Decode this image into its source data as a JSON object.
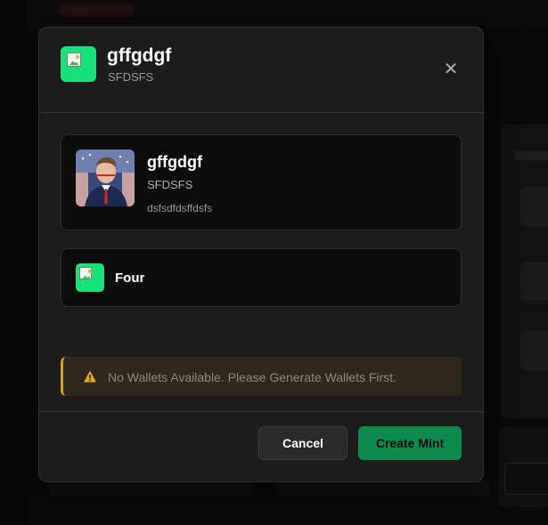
{
  "modal": {
    "title": "gffgdgf",
    "subtitle": "SFDSFS",
    "close_label": "✕"
  },
  "token": {
    "name": "gffgdgf",
    "symbol": "SFDSFS",
    "description": "dsfsdfdsffdsfs"
  },
  "platform": {
    "name": "Four"
  },
  "warning": {
    "message": "No Wallets Available. Please Generate Wallets First."
  },
  "actions": {
    "cancel_label": "Cancel",
    "create_label": "Create Mint"
  },
  "colors": {
    "accent_green": "#18e07a",
    "primary_button": "#0f8a4e",
    "warning_border": "#d6a425"
  },
  "icons": {
    "header": "broken-image-icon",
    "close": "close-icon",
    "warning": "warning-triangle-icon",
    "platform": "broken-image-icon"
  }
}
